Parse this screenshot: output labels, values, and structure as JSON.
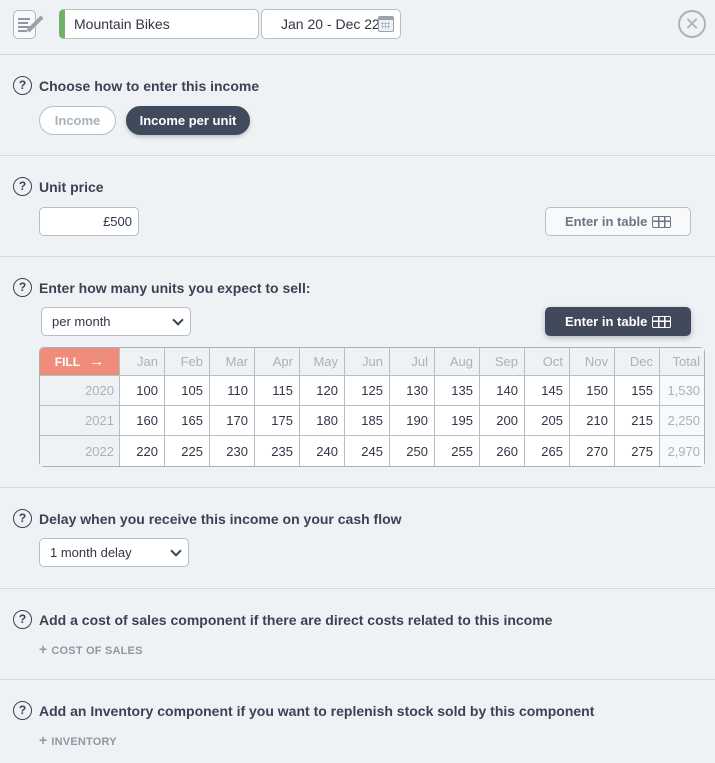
{
  "header": {
    "notes_icon": "notes-edit-icon",
    "name_value": "Mountain Bikes",
    "name_color": "#6fb26a",
    "date_range": "Jan 20 - Dec 22",
    "calendar_icon": "calendar-icon",
    "close_icon": "close-circle-icon"
  },
  "entry_mode": {
    "title": "Choose how to enter this income",
    "options": [
      {
        "label": "Income",
        "selected": false
      },
      {
        "label": "Income per unit",
        "selected": true
      }
    ]
  },
  "unit_price": {
    "title": "Unit price",
    "value": "£500",
    "table_button": "Enter in table"
  },
  "units": {
    "title": "Enter how many units you expect to sell:",
    "frequency": "per month",
    "table_button": "Enter in table",
    "fill_label": "FILL",
    "columns": [
      "Jan",
      "Feb",
      "Mar",
      "Apr",
      "May",
      "Jun",
      "Jul",
      "Aug",
      "Sep",
      "Oct",
      "Nov",
      "Dec",
      "Total"
    ],
    "rows": [
      {
        "year": "2020",
        "values": [
          "100",
          "105",
          "110",
          "115",
          "120",
          "125",
          "130",
          "135",
          "140",
          "145",
          "150",
          "155"
        ],
        "total": "1,530"
      },
      {
        "year": "2021",
        "values": [
          "160",
          "165",
          "170",
          "175",
          "180",
          "185",
          "190",
          "195",
          "200",
          "205",
          "210",
          "215"
        ],
        "total": "2,250"
      },
      {
        "year": "2022",
        "values": [
          "220",
          "225",
          "230",
          "235",
          "240",
          "245",
          "250",
          "255",
          "260",
          "265",
          "270",
          "275"
        ],
        "total": "2,970"
      }
    ]
  },
  "delay": {
    "title": "Delay when you receive this income on your cash flow",
    "value": "1 month delay"
  },
  "cost_of_sales": {
    "title": "Add a cost of sales component if there are direct costs related to this income",
    "link": "COST OF SALES"
  },
  "inventory": {
    "title": "Add an Inventory component if you want to replenish stock sold by this component",
    "link": "INVENTORY"
  },
  "help_glyph": "?",
  "close_glyph": "✕",
  "fill_arrow": "→",
  "plus_glyph": "+"
}
